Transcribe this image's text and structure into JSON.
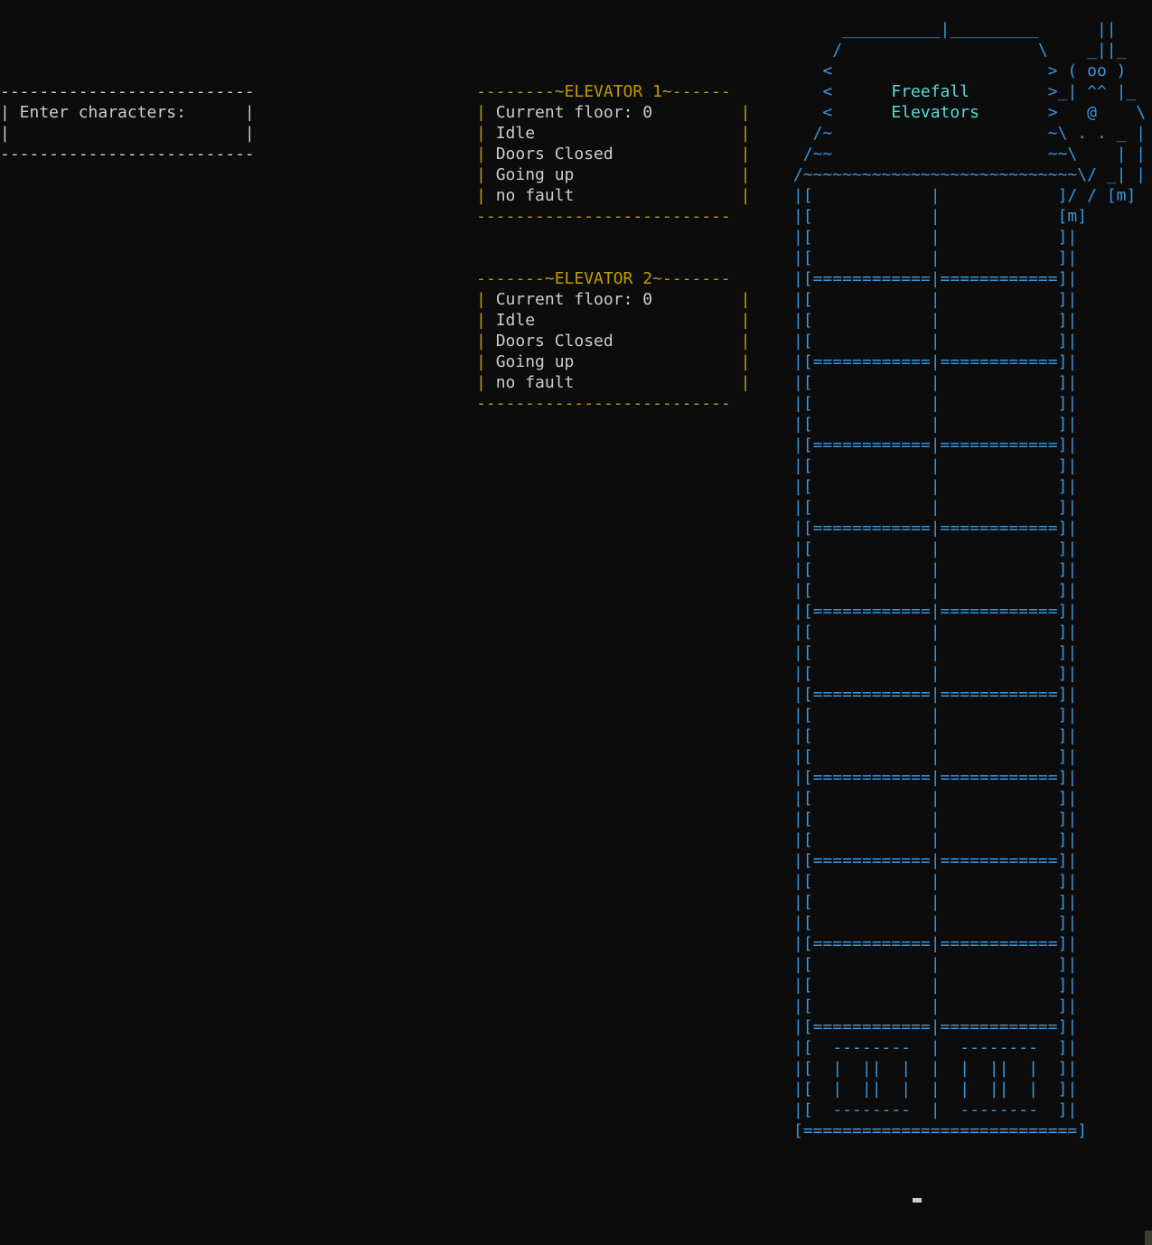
{
  "input_box": {
    "border_top": "--------------------------",
    "prompt_line": "| Enter characters:      |",
    "input_line": "|                        |",
    "border_bottom": "--------------------------"
  },
  "elevators": [
    {
      "header": "--------~ELEVATOR 1~------",
      "floor": "Current floor: 0",
      "state": "Idle",
      "doors": "Doors Closed",
      "direction": "Going up",
      "fault": "no fault",
      "footer": "--------------------------"
    },
    {
      "header": "-------~ELEVATOR 2~-------",
      "floor": "Current floor: 0",
      "state": "Idle",
      "doors": "Doors Closed",
      "direction": "Going up",
      "fault": "no fault",
      "footer": "--------------------------"
    }
  ],
  "building": {
    "sign_line1": "Freefall",
    "sign_line2": "Elevators",
    "roof": [
      "     __________|_________      ||",
      "    /                    \\    _||_",
      "   <                      > ( oo )",
      "   <                      >_| ^^ |_",
      "   <                      >   @    \\",
      "  /~                      ~\\ . . _ |",
      " /~~                      ~~\\    | |",
      "/~~~~~~~~~~~~~~~~~~~~~~~~~~~~\\/ _| |",
      "|[            |            ]/ / [m]",
      "|[            |            [m]"
    ],
    "shaft_row": "|[            |            ]|",
    "floor_divider": "|[============|============]|",
    "lobby": [
      "|[  --------  |  --------  ]|",
      "|[  |  ||  |  |  |  ||  |  ]|",
      "|[  |  ||  |  |  |  ||  |  ]|",
      "|[  --------  |  --------  ]|"
    ],
    "base": "[============================]",
    "upper_floor_count": 10,
    "rows_per_floor": 4
  },
  "colors": {
    "background": "#0c0c0c",
    "text": "#cccccc",
    "elevator_panel": "#c19c00",
    "building": "#3a96dd",
    "sign": "#61d6d6"
  }
}
